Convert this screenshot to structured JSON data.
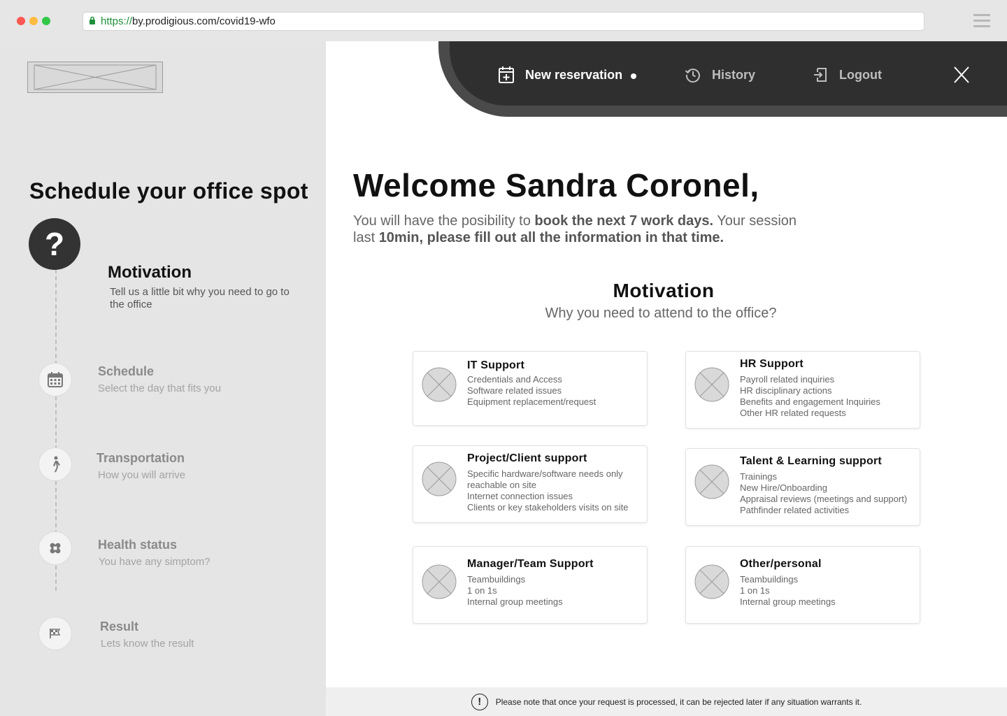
{
  "browser": {
    "url_protocol": "https://",
    "url_rest": "by.prodigious.com/covid19-wfo"
  },
  "sidebar": {
    "title": "Schedule your office spot",
    "steps": [
      {
        "title": "Motivation",
        "subtitle": "Tell us a little bit why you need to go to the office",
        "icon": "question-mark-icon",
        "active": true
      },
      {
        "title": "Schedule",
        "subtitle": "Select the day that fits you",
        "icon": "calendar-icon",
        "active": false
      },
      {
        "title": "Transportation",
        "subtitle": "How you will arrive",
        "icon": "walking-person-icon",
        "active": false
      },
      {
        "title": "Health status",
        "subtitle": "You have any simptom?",
        "icon": "bandage-icon",
        "active": false
      },
      {
        "title": "Result",
        "subtitle": "Lets know the result",
        "icon": "flag-icon",
        "active": false
      }
    ]
  },
  "nav": {
    "new_reservation": "New reservation",
    "history": "History",
    "logout": "Logout"
  },
  "main": {
    "welcome": "Welcome Sandra Coronel,",
    "intro_1": "You will have the posibility to ",
    "intro_2": "book the next 7 work days.",
    "intro_3": " Your session last ",
    "intro_4": "10min, please fill out all the information in that time.",
    "section_title": "Motivation",
    "section_subtitle": "Why you need to attend to the office?",
    "cards": [
      {
        "title": "IT Support",
        "items": [
          "Credentials and Access",
          "Software related issues",
          "Equipment replacement/request"
        ]
      },
      {
        "title": "HR Support",
        "items": [
          "Payroll related inquiries",
          "HR disciplinary actions",
          "Benefits and engagement Inquiries",
          "Other HR related requests"
        ]
      },
      {
        "title": "Project/Client support",
        "items": [
          "Specific hardware/software needs only reachable on site",
          "Internet connection issues",
          "Clients or key stakeholders visits on site"
        ]
      },
      {
        "title": "Talent & Learning support",
        "items": [
          "Trainings",
          "New Hire/Onboarding",
          "Appraisal reviews (meetings and support)",
          "Pathfinder related activities"
        ]
      },
      {
        "title": "Manager/Team Support",
        "items": [
          "Teambuildings",
          "1 on 1s",
          "Internal group meetings"
        ]
      },
      {
        "title": "Other/personal",
        "items": [
          "Teambuildings",
          "1 on 1s",
          "Internal group meetings"
        ]
      }
    ]
  },
  "footer": {
    "note": "Please note that once your request is processed, it can be rejected later if any situation warrants it."
  },
  "colors": {
    "sidebar_bg": "#e5e5e5",
    "nav_dark": "#2f2f2f",
    "nav_mid": "#4a4a4a",
    "active_step": "#333333"
  }
}
